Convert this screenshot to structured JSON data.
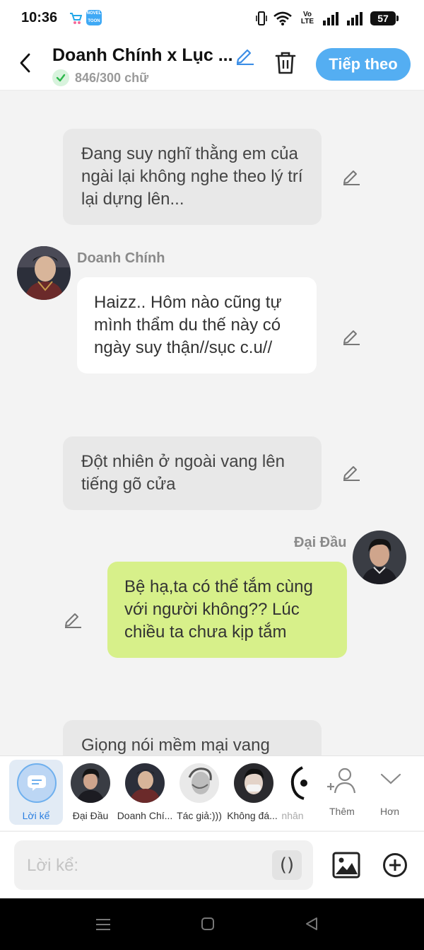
{
  "status_bar": {
    "time": "10:36",
    "volte": "Vo LTE",
    "volte_top": "Vo",
    "volte_bottom": "LTE",
    "battery": "57",
    "app2_label": "NOVEL TOON"
  },
  "header": {
    "title": "Doanh Chính x Lục ...",
    "word_count": "846/300 chữ",
    "next_label": "Tiếp theo"
  },
  "chat": {
    "messages": [
      {
        "type": "narration",
        "text": "Đang suy nghĩ thằng em của ngài lại không nghe theo lý trí lại dựng lên..."
      },
      {
        "type": "character",
        "side": "left",
        "sender": "Doanh Chính",
        "text": "Haizz.. Hôm nào cũng tự mình thẩm du thế này có ngày suy thận//sục c.u//"
      },
      {
        "type": "narration",
        "text": "Đột nhiên ở ngoài vang lên tiếng gõ cửa"
      },
      {
        "type": "character",
        "side": "right",
        "sender": "Đại Đầu",
        "text": "Bệ hạ,ta có thể tắm cùng với người không?? Lúc chiều ta chưa kịp tắm"
      },
      {
        "type": "narration",
        "text": "Giọng nói mềm mại vang"
      }
    ]
  },
  "character_bar": {
    "items": [
      {
        "label": "Lời kể",
        "selected": true
      },
      {
        "label": "Đại Đầu"
      },
      {
        "label": "Doanh Chí..."
      },
      {
        "label": "Tác giả:)))"
      },
      {
        "label": "Không đá..."
      },
      {
        "label": "nhân"
      }
    ],
    "add_label": "Thêm",
    "more_label": "Hơn"
  },
  "input_bar": {
    "placeholder": "Lời kể:",
    "paren_label": "()"
  },
  "colors": {
    "accent": "#54aef2",
    "bubble_right": "#d7f08a",
    "narration_bg": "#e8e8e8",
    "bubble_left": "#ffffff",
    "chat_bg": "#f3f3f3"
  },
  "icons": [
    "back-arrow-icon",
    "pencil-icon",
    "trash-icon",
    "check-icon",
    "narration-icon",
    "add-person-icon",
    "chevron-down-icon",
    "image-icon",
    "plus-circle-icon",
    "nav-menu-icon",
    "nav-home-icon",
    "nav-back-icon"
  ]
}
